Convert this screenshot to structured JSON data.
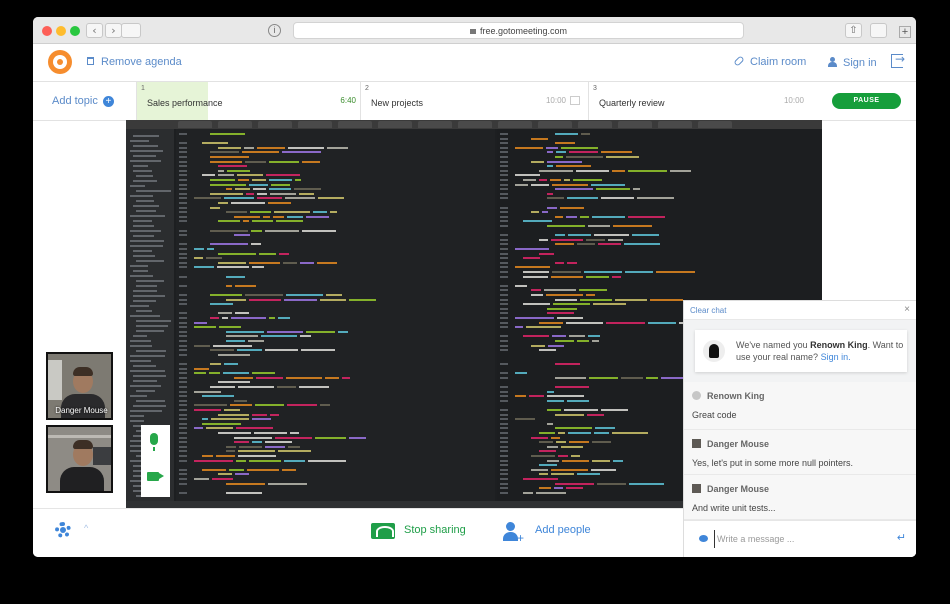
{
  "browser": {
    "url": "free.gotomeeting.com",
    "back_glyph": "‹",
    "forward_glyph": "›",
    "info_glyph": "i",
    "plus_glyph": "+",
    "share_glyph": "⇧"
  },
  "header": {
    "remove_agenda": "Remove agenda",
    "claim_room": "Claim room",
    "sign_in": "Sign in"
  },
  "agenda": {
    "add_topic": "Add topic",
    "add_topic_glyph": "+",
    "topics": [
      {
        "number": "1",
        "name": "Sales performance",
        "time": "6:40",
        "progress": 0.32
      },
      {
        "number": "2",
        "name": "New projects",
        "time": "10:00"
      },
      {
        "number": "3",
        "name": "Quarterly review",
        "time": "10:00"
      }
    ],
    "pause_label": "PAUSE"
  },
  "webcams": [
    {
      "name": "Danger Mouse"
    },
    {
      "name": ""
    }
  ],
  "bottom_bar": {
    "stop_sharing": "Stop sharing",
    "add_people": "Add people",
    "chevron_glyph": "^"
  },
  "chat": {
    "clear_chat": "Clear chat",
    "close_glyph": "×",
    "notice": {
      "prefix": "We've named you",
      "name": "Renown King",
      "suffix": ". Want to use your real name?",
      "link": "Sign in."
    },
    "messages": [
      {
        "sender": "Renown King",
        "text": "Great code"
      },
      {
        "sender": "Danger Mouse",
        "text": "Yes, let's put in some more null pointers."
      },
      {
        "sender": "Danger Mouse",
        "text": "And write unit tests..."
      }
    ],
    "compose_placeholder": "Write a message ...",
    "enter_glyph": "↵"
  },
  "colors": {
    "brand_blue": "#5b8bc9",
    "share_green": "#1f9e48",
    "pause_green": "#169e3b",
    "logo_orange": "#f68d2e"
  }
}
